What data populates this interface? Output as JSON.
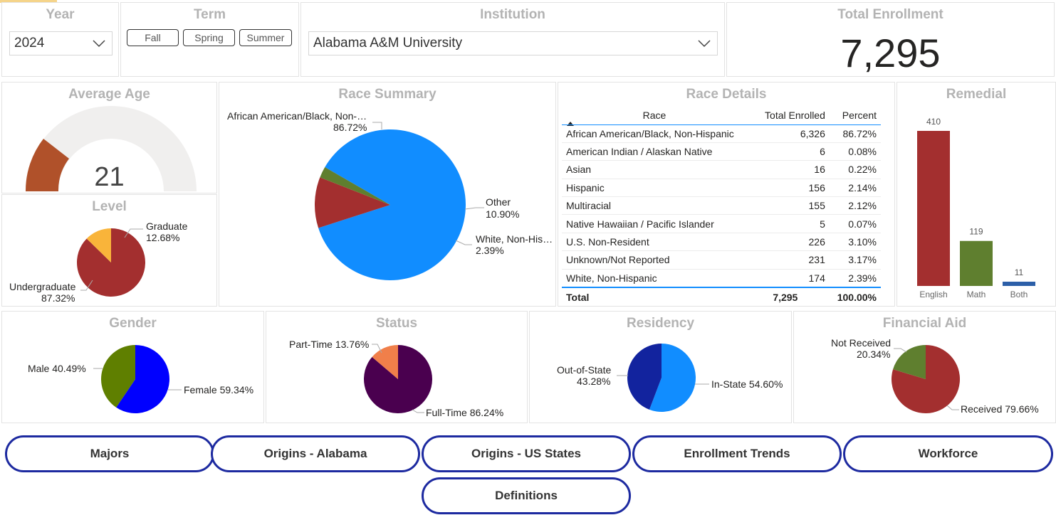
{
  "filters": {
    "year": {
      "title": "Year",
      "value": "2024"
    },
    "term": {
      "title": "Term",
      "options": [
        "Fall",
        "Spring",
        "Summer"
      ]
    },
    "institution": {
      "title": "Institution",
      "value": "Alabama A&M University"
    }
  },
  "total_enrollment": {
    "title": "Total Enrollment",
    "value": "7,295"
  },
  "average_age": {
    "title": "Average Age",
    "value": "21"
  },
  "colors": {
    "accent_red": "#a32f2f",
    "pie_blue": "#118dff",
    "gauge_fill": "#b0512a",
    "gauge_bg": "#f0efee",
    "nav_border": "#1d2aa0"
  },
  "charts": {
    "level": {
      "title": "Level",
      "labels": [
        "Graduate",
        "12.68%",
        "Undergraduate",
        "87.32%"
      ]
    },
    "race_summary": {
      "title": "Race Summary",
      "labels": [
        "African American/Black, Non-…",
        "86.72%",
        "Other",
        "10.90%",
        "White, Non-His…",
        "2.39%"
      ]
    },
    "gender": {
      "title": "Gender",
      "labels": [
        "Male 40.49%",
        "Female 59.34%"
      ]
    },
    "status": {
      "title": "Status",
      "labels": [
        "Part-Time 13.76%",
        "Full-Time 86.24%"
      ]
    },
    "residency": {
      "title": "Residency",
      "labels": [
        "Out-of-State",
        "43.28%",
        "In-State 54.60%"
      ]
    },
    "financial_aid": {
      "title": "Financial Aid",
      "labels": [
        "Not Received",
        "20.34%",
        "Received 79.66%"
      ]
    },
    "remedial": {
      "title": "Remedial"
    }
  },
  "race_details": {
    "title": "Race Details",
    "headers": [
      "Race",
      "Total Enrolled",
      "Percent"
    ],
    "rows": [
      [
        "African American/Black, Non-Hispanic",
        "6,326",
        "86.72%"
      ],
      [
        "American Indian / Alaskan Native",
        "6",
        "0.08%"
      ],
      [
        "Asian",
        "16",
        "0.22%"
      ],
      [
        "Hispanic",
        "156",
        "2.14%"
      ],
      [
        "Multiracial",
        "155",
        "2.12%"
      ],
      [
        "Native Hawaiian / Pacific Islander",
        "5",
        "0.07%"
      ],
      [
        "U.S. Non-Resident",
        "226",
        "3.10%"
      ],
      [
        "Unknown/Not Reported",
        "231",
        "3.17%"
      ],
      [
        "White, Non-Hispanic",
        "174",
        "2.39%"
      ]
    ],
    "total": [
      "Total",
      "7,295",
      "100.00%"
    ]
  },
  "chart_data": [
    {
      "type": "pie",
      "title": "Level",
      "categories": [
        "Undergraduate",
        "Graduate"
      ],
      "values": [
        87.32,
        12.68
      ]
    },
    {
      "type": "pie",
      "title": "Race Summary",
      "categories": [
        "African American/Black, Non-Hispanic",
        "Other",
        "White, Non-Hispanic"
      ],
      "values": [
        86.72,
        10.9,
        2.39
      ]
    },
    {
      "type": "pie",
      "title": "Gender",
      "categories": [
        "Female",
        "Male"
      ],
      "values": [
        59.34,
        40.49
      ]
    },
    {
      "type": "pie",
      "title": "Status",
      "categories": [
        "Full-Time",
        "Part-Time"
      ],
      "values": [
        86.24,
        13.76
      ]
    },
    {
      "type": "pie",
      "title": "Residency",
      "categories": [
        "In-State",
        "Out-of-State"
      ],
      "values": [
        54.6,
        43.28
      ]
    },
    {
      "type": "pie",
      "title": "Financial Aid",
      "categories": [
        "Received",
        "Not Received"
      ],
      "values": [
        79.66,
        20.34
      ]
    },
    {
      "type": "bar",
      "title": "Remedial",
      "categories": [
        "English",
        "Math",
        "Both"
      ],
      "values": [
        410,
        119,
        11
      ]
    }
  ],
  "nav": {
    "row1": [
      "Majors",
      "Origins - Alabama",
      "Origins - US States",
      "Enrollment Trends",
      "Workforce"
    ],
    "row2": [
      "Definitions"
    ]
  }
}
